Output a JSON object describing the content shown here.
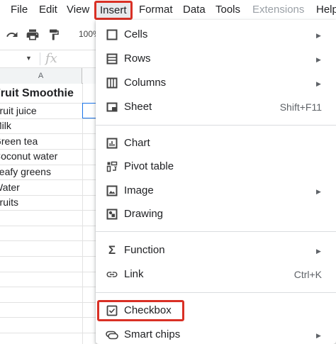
{
  "menubar": {
    "file": "File",
    "edit": "Edit",
    "view": "View",
    "insert": "Insert",
    "format": "Format",
    "data": "Data",
    "tools": "Tools",
    "extensions": "Extensions",
    "help": "Help"
  },
  "toolbar": {
    "zoom": "100%"
  },
  "formula": {
    "fx_label": "fx"
  },
  "sheet": {
    "column_a": "A",
    "cells": [
      "Fruit Smoothie",
      "Fruit juice",
      "Milk",
      "Green tea",
      "Coconut water",
      "Leafy greens",
      "Water",
      "Fruits"
    ]
  },
  "insert_menu": {
    "cells": "Cells",
    "rows": "Rows",
    "columns": "Columns",
    "sheet": "Sheet",
    "sheet_shortcut": "Shift+F11",
    "chart": "Chart",
    "pivot_table": "Pivot table",
    "image": "Image",
    "drawing": "Drawing",
    "function": "Function",
    "link": "Link",
    "link_shortcut": "Ctrl+K",
    "checkbox": "Checkbox",
    "smart_chips": "Smart chips"
  },
  "colors": {
    "highlight_red": "#d93025",
    "selection_blue": "#1a73e8"
  }
}
